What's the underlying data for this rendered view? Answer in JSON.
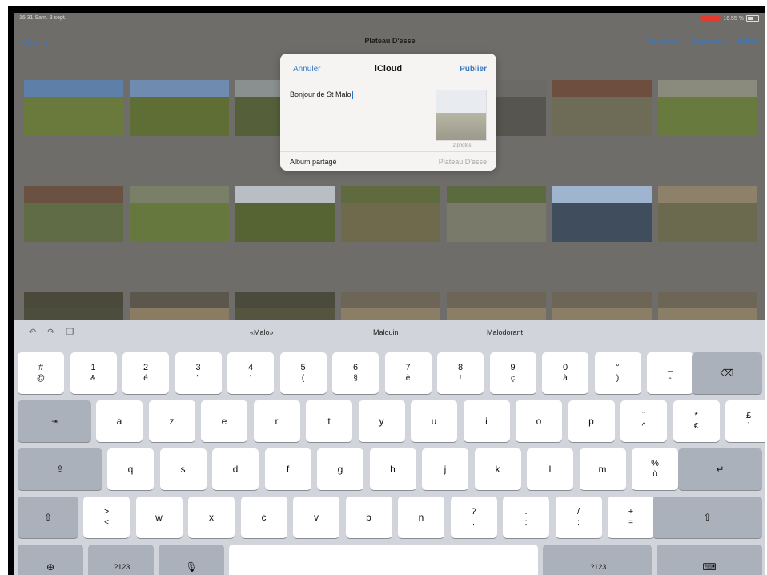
{
  "status": {
    "time": "16:31  Sam. 8 sept.",
    "battery": "16.55 %"
  },
  "nav": {
    "back": "Albums",
    "title": "Plateau D'esse",
    "people": "Personnes",
    "slideshow": "Diaporama",
    "select": "Sélect."
  },
  "popup": {
    "cancel": "Annuler",
    "title": "iCloud",
    "post": "Publier",
    "message": "Bonjour de St Malo",
    "preview_caption": "2 photos",
    "album_label": "Album partagé",
    "album_value": "Plateau D'esse"
  },
  "suggestions": [
    "«Malo»",
    "Malouin",
    "Malodorant"
  ],
  "keyboard": {
    "row1": [
      [
        "#",
        "@"
      ],
      [
        "1",
        "&"
      ],
      [
        "2",
        "é"
      ],
      [
        "3",
        "\""
      ],
      [
        "4",
        "'"
      ],
      [
        "5",
        "("
      ],
      [
        "6",
        "§"
      ],
      [
        "7",
        "è"
      ],
      [
        "8",
        "!"
      ],
      [
        "9",
        "ç"
      ],
      [
        "0",
        "à"
      ],
      [
        "°",
        ")"
      ],
      [
        "_",
        "-"
      ]
    ],
    "row2": [
      "a",
      "z",
      "e",
      "r",
      "t",
      "y",
      "u",
      "i",
      "o",
      "p"
    ],
    "row2_extra": [
      [
        "¨",
        "^"
      ],
      [
        "*",
        "€"
      ],
      [
        "£",
        "`"
      ]
    ],
    "row3": [
      "q",
      "s",
      "d",
      "f",
      "g",
      "h",
      "j",
      "k",
      "l",
      "m"
    ],
    "row3_extra": [
      [
        "%",
        "ù"
      ]
    ],
    "row4_first": [
      ">",
      "<"
    ],
    "row4": [
      "w",
      "x",
      "c",
      "v",
      "b",
      "n"
    ],
    "row4_extra": [
      [
        "?",
        ","
      ],
      [
        ".",
        ";"
      ],
      [
        "/",
        ":"
      ],
      [
        "+",
        "="
      ]
    ],
    "numbers_label": ".?123"
  },
  "colors": {
    "accent": "#3a78c4",
    "keyboard_bg": "#d1d4da"
  }
}
